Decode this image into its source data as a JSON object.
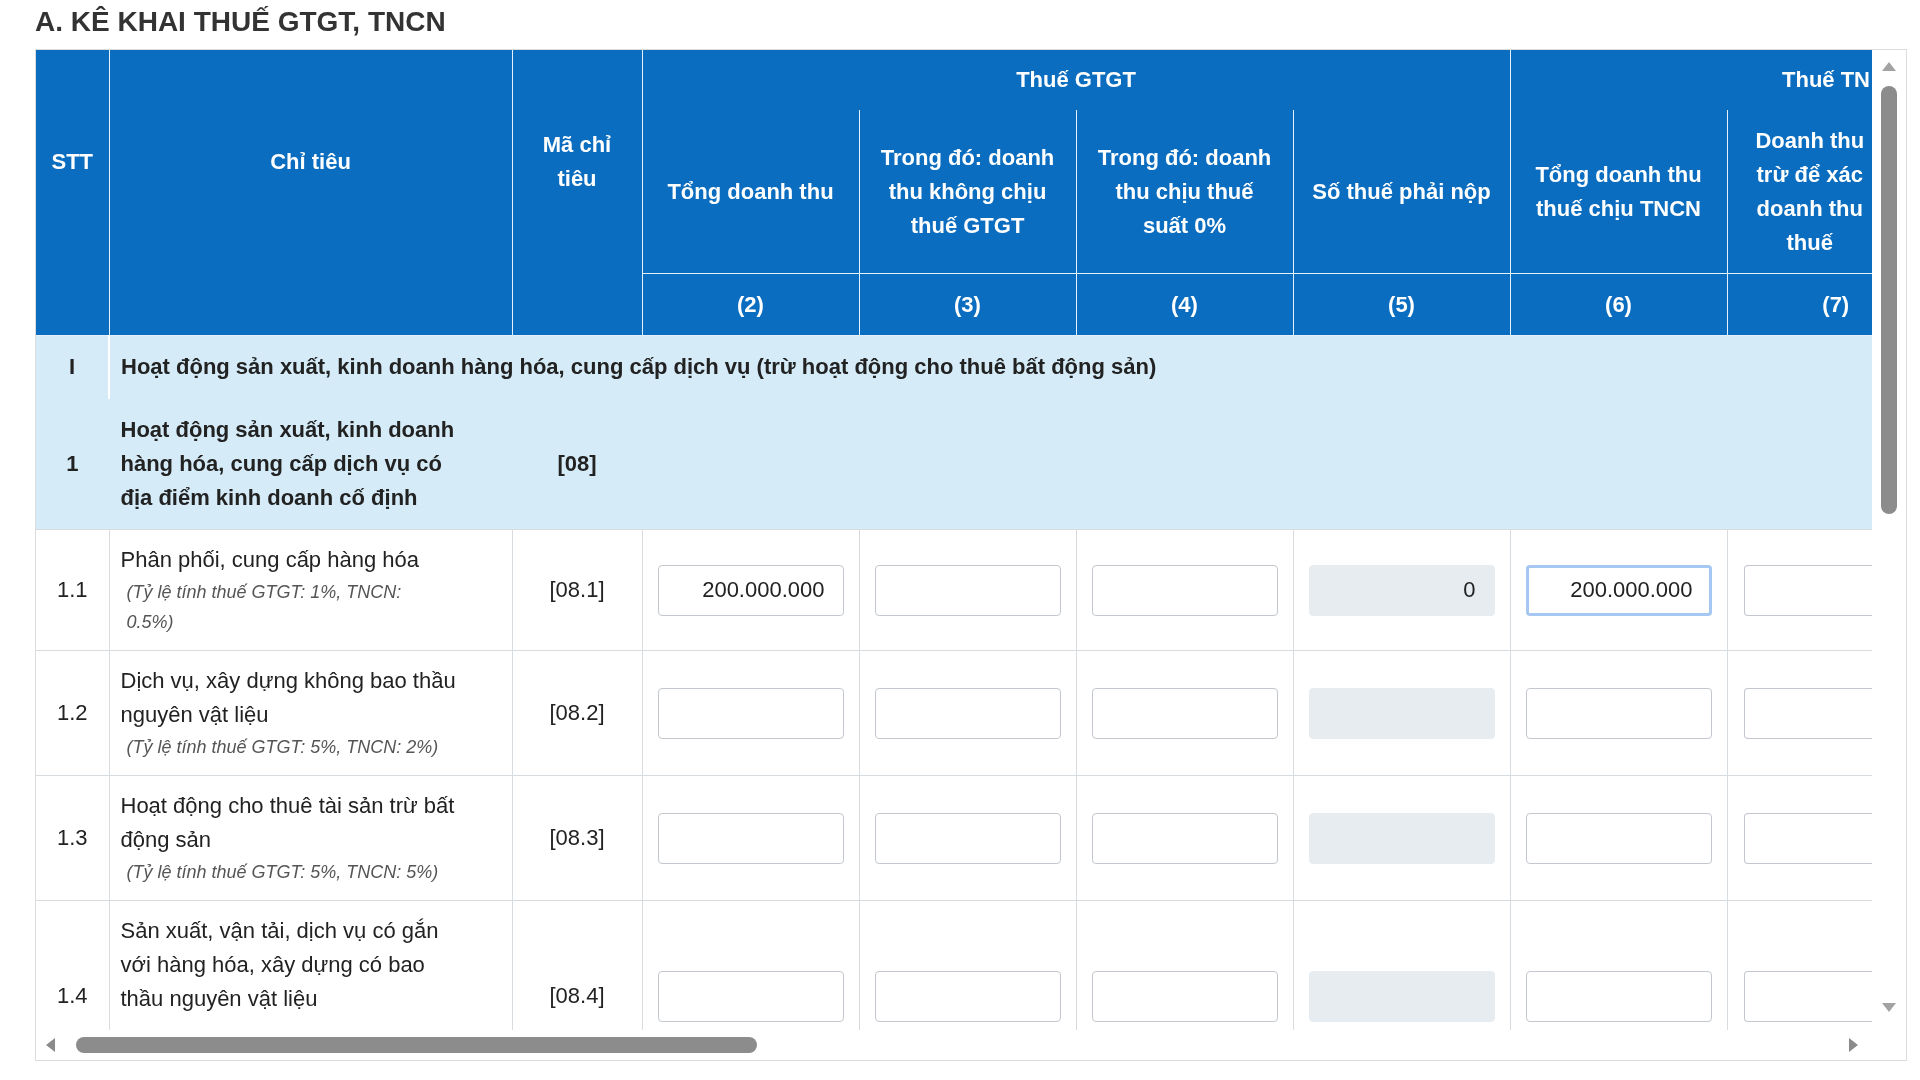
{
  "title": "A. KÊ KHAI THUẾ GTGT, TNCN",
  "table": {
    "header": {
      "stt": "STT",
      "description": "Chỉ tiêu",
      "code": "Mã chỉ\ntiêu",
      "groups": [
        {
          "label": "Thuế GTGT",
          "columns": [
            {
              "label": "Tổng doanh thu",
              "number": "(2)"
            },
            {
              "label": "Trong đó: doanh\nthu không chịu\nthuế GTGT",
              "number": "(3)"
            },
            {
              "label": "Trong đó: doanh\nthu chịu thuế\nsuất 0%",
              "number": "(4)"
            },
            {
              "label": "Số thuế phải nộp",
              "number": "(5)"
            }
          ]
        },
        {
          "label": "Thuế TN",
          "columns": [
            {
              "label": "Tổng doanh thu\nthuế chịu TNCN",
              "number": "(6)"
            },
            {
              "label": "Doanh thu\ntrừ để xác\ndoanh thu\nthuế",
              "number": "(7)"
            }
          ]
        }
      ]
    },
    "rows": [
      {
        "kind": "section",
        "stt": "I",
        "label": "Hoạt động sản xuất, kinh doanh hàng hóa, cung cấp dịch vụ (trừ hoạt động cho thuê bất động sản)"
      },
      {
        "kind": "group",
        "stt": "1",
        "label": "Hoạt động sản xuất, kinh doanh\nhàng hóa, cung cấp dịch vụ có\nđịa điểm kinh doanh cố định",
        "code": "[08]"
      },
      {
        "kind": "item",
        "stt": "1.1",
        "label": "Phân phối, cung cấp hàng hóa",
        "note": "(Tỷ lệ tính thuế GTGT: 1%, TNCN:\n0.5%)",
        "code": "[08.1]",
        "fields": [
          {
            "value": "200.000.000",
            "disabled": false,
            "focused": false
          },
          {
            "disabled": false,
            "focused": false
          },
          {
            "disabled": false,
            "focused": false
          },
          {
            "value": "0",
            "disabled": true,
            "focused": false
          },
          {
            "value": "200.000.000",
            "disabled": false,
            "focused": true
          },
          {
            "disabled": false,
            "focused": false
          }
        ]
      },
      {
        "kind": "item",
        "stt": "1.2",
        "label": "Dịch vụ, xây dựng không bao thầu\nnguyên vật liệu",
        "note": "(Tỷ lệ tính thuế GTGT: 5%, TNCN: 2%)",
        "code": "[08.2]",
        "fields": [
          {
            "disabled": false,
            "focused": false
          },
          {
            "disabled": false,
            "focused": false
          },
          {
            "disabled": false,
            "focused": false
          },
          {
            "disabled": true,
            "focused": false
          },
          {
            "disabled": false,
            "focused": false
          },
          {
            "disabled": false,
            "focused": false
          }
        ]
      },
      {
        "kind": "item",
        "stt": "1.3",
        "label": "Hoạt động cho thuê tài sản trừ bất\nđộng sản",
        "note": "(Tỷ lệ tính thuế GTGT: 5%, TNCN: 5%)",
        "code": "[08.3]",
        "fields": [
          {
            "disabled": false,
            "focused": false
          },
          {
            "disabled": false,
            "focused": false
          },
          {
            "disabled": false,
            "focused": false
          },
          {
            "disabled": true,
            "focused": false
          },
          {
            "disabled": false,
            "focused": false
          },
          {
            "disabled": false,
            "focused": false
          }
        ]
      },
      {
        "kind": "item",
        "stt": "1.4",
        "label": "Sản xuất, vận tải, dịch vụ có gắn\nvới hàng hóa, xây dựng có bao\nthầu nguyên vật liệu",
        "code": "[08.4]",
        "fields": [
          {
            "disabled": false,
            "focused": false
          },
          {
            "disabled": false,
            "focused": false
          },
          {
            "disabled": false,
            "focused": false
          },
          {
            "disabled": true,
            "focused": false
          },
          {
            "disabled": false,
            "focused": false
          },
          {
            "disabled": false,
            "focused": false
          }
        ]
      }
    ]
  }
}
